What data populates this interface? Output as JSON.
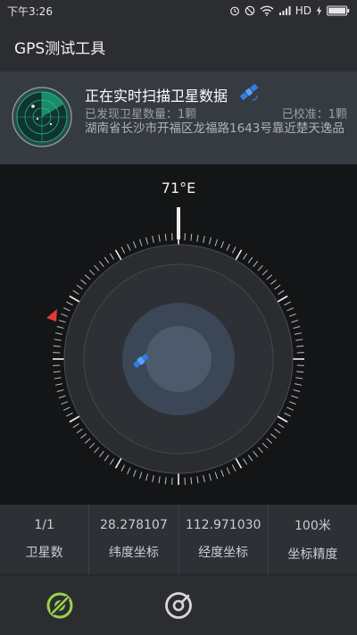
{
  "status_bar": {
    "time": "下午3:26",
    "carrier": "HD",
    "icons": [
      "alarm-icon",
      "mute-icon",
      "wifi-icon",
      "signal-icon",
      "charging-icon",
      "battery-icon"
    ]
  },
  "app_bar": {
    "title": "GPS测试工具"
  },
  "scan_card": {
    "title": "正在实时扫描卫星数据",
    "found": "已发现卫星数量：1颗",
    "calibrated": "已校准：1颗",
    "address": "湖南省长沙市开福区龙福路1643号靠近楚天逸品",
    "icons": [
      "radar-icon",
      "satellite-icon"
    ]
  },
  "compass": {
    "heading": "71°E",
    "marker_color": "#e53935",
    "satellite_color": "#2f7fe0",
    "icons": [
      "north-marker-icon",
      "satellite-icon"
    ]
  },
  "stats": [
    {
      "value": "1/1",
      "label": "卫星数"
    },
    {
      "value": "28.278107",
      "label": "纬度坐标"
    },
    {
      "value": "112.971030",
      "label": "经度坐标"
    },
    {
      "value": "100米",
      "label": "坐标精度"
    }
  ],
  "bottom_nav": {
    "items": [
      {
        "name": "gps",
        "icon": "gps-icon",
        "active": true,
        "color": "#9bd14a"
      },
      {
        "name": "compass",
        "icon": "compass-icon",
        "active": false,
        "color": "#d8d8d8"
      }
    ]
  }
}
